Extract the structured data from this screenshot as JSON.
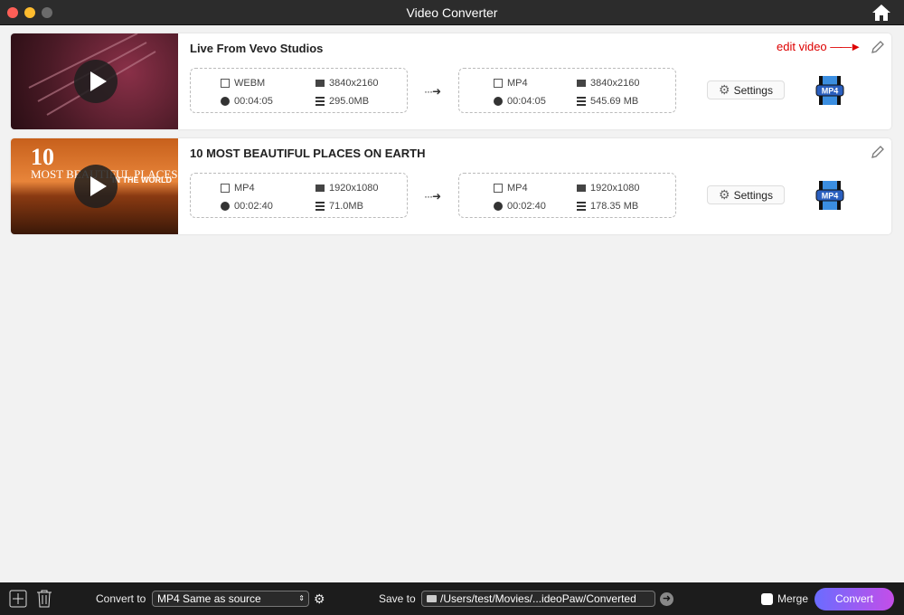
{
  "window": {
    "title": "Video Converter"
  },
  "videos": [
    {
      "title": "Live From Vevo Studios",
      "source": {
        "format": "WEBM",
        "resolution": "3840x2160",
        "duration": "00:04:05",
        "size": "295.0MB"
      },
      "target": {
        "format": "MP4",
        "resolution": "3840x2160",
        "duration": "00:04:05",
        "size": "545.69 MB"
      },
      "settings_label": "Settings",
      "format_badge": "MP4",
      "annotation": "edit video"
    },
    {
      "title": "10 MOST BEAUTIFUL PLACES ON EARTH",
      "thumb_text": [
        "10",
        "MOST BEAUTIFUL PLACES",
        "IN THE WORLD"
      ],
      "source": {
        "format": "MP4",
        "resolution": "1920x1080",
        "duration": "00:02:40",
        "size": "71.0MB"
      },
      "target": {
        "format": "MP4",
        "resolution": "1920x1080",
        "duration": "00:02:40",
        "size": "178.35 MB"
      },
      "settings_label": "Settings",
      "format_badge": "MP4"
    }
  ],
  "bottom": {
    "convert_to_label": "Convert to",
    "convert_to_value": "MP4 Same as source",
    "save_to_label": "Save to",
    "save_to_path": "/Users/test/Movies/...ideoPaw/Converted",
    "merge_label": "Merge",
    "convert_button": "Convert"
  },
  "colors": {
    "accent_start": "#6a6cff",
    "accent_end": "#c44ee8",
    "annotation": "#dd0000"
  }
}
